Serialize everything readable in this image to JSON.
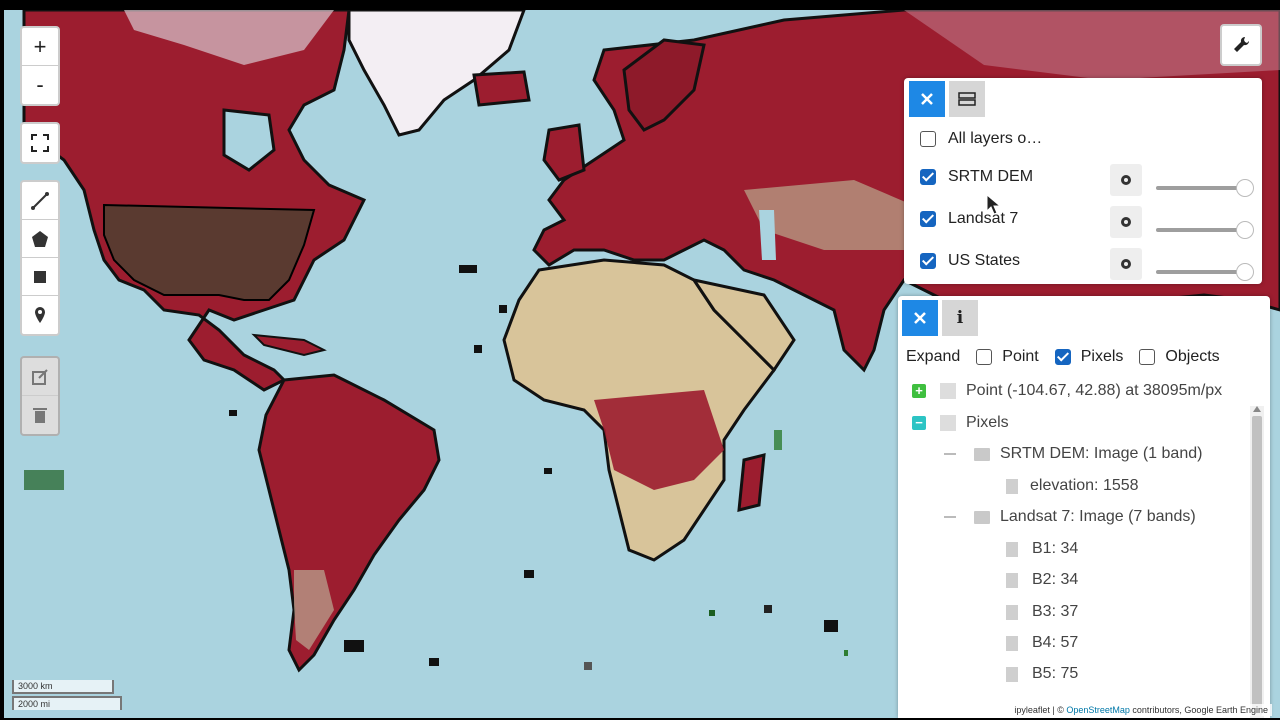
{
  "map": {
    "zoom_in_label": "+",
    "zoom_out_label": "-",
    "scale_km": "3000 km",
    "scale_mi": "2000 mi",
    "attribution_prefix": "ipyleaflet | © ",
    "attribution_link": "OpenStreetMap",
    "attribution_suffix": " contributors, Google Earth Engine",
    "colors": {
      "ocean": "#aad3df",
      "land": "#9c1d2f",
      "desert": "#d8c49a",
      "ice": "#f2eef2",
      "accent": "#1e88e5"
    }
  },
  "toolbar": {
    "icons": [
      "fullscreen-icon",
      "polyline-icon",
      "polygon-icon",
      "rectangle-icon",
      "marker-icon",
      "edit-icon",
      "trash-icon",
      "wrench-icon"
    ]
  },
  "layers": {
    "all_layers_label": "All layers o…",
    "items": [
      {
        "label": "SRTM DEM",
        "checked": true,
        "opacity": 1.0
      },
      {
        "label": "Landsat 7",
        "checked": true,
        "opacity": 1.0
      },
      {
        "label": "US States",
        "checked": true,
        "opacity": 1.0
      }
    ]
  },
  "inspector": {
    "expand_label": "Expand",
    "point_label": "Point",
    "pixels_label": "Pixels",
    "objects_label": "Objects",
    "point_checked": false,
    "pixels_checked": true,
    "objects_checked": false,
    "tree": {
      "point": "Point (-104.67, 42.88) at 38095m/px",
      "pixels": "Pixels",
      "srtm": "SRTM DEM: Image (1 band)",
      "elevation": "elevation: 1558",
      "landsat": "Landsat 7: Image (7 bands)",
      "bands": [
        "B1: 34",
        "B2: 34",
        "B3: 37",
        "B4: 57",
        "B5: 75"
      ]
    }
  }
}
